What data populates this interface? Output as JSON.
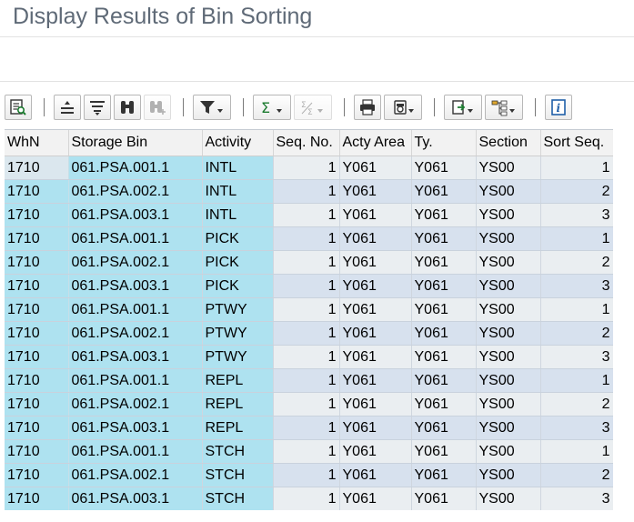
{
  "window": {
    "title": "Display Results of Bin Sorting"
  },
  "toolbar": {
    "buttons": [
      {
        "name": "details-icon",
        "disabled": false
      },
      {
        "name": "sort-ascending-icon",
        "disabled": false
      },
      {
        "name": "sort-descending-icon",
        "disabled": false
      },
      {
        "name": "find-icon",
        "disabled": false
      },
      {
        "name": "find-next-icon",
        "disabled": true
      },
      {
        "name": "filter-icon",
        "disabled": false
      },
      {
        "name": "total-icon",
        "disabled": false
      },
      {
        "name": "subtotal-icon",
        "disabled": true
      },
      {
        "name": "print-icon",
        "disabled": false
      },
      {
        "name": "views-icon",
        "disabled": false
      },
      {
        "name": "export-icon",
        "disabled": false
      },
      {
        "name": "layout-icon",
        "disabled": false
      },
      {
        "name": "info-icon",
        "disabled": false
      }
    ]
  },
  "table": {
    "columns": [
      "WhN",
      "Storage Bin",
      "Activity",
      "Seq. No.",
      "Acty Area",
      "Ty.",
      "Section",
      "Sort Seq."
    ],
    "rows": [
      [
        "1710",
        "061.PSA.001.1",
        "INTL",
        "1",
        "Y061",
        "Y061",
        "YS00",
        "1"
      ],
      [
        "1710",
        "061.PSA.002.1",
        "INTL",
        "1",
        "Y061",
        "Y061",
        "YS00",
        "2"
      ],
      [
        "1710",
        "061.PSA.003.1",
        "INTL",
        "1",
        "Y061",
        "Y061",
        "YS00",
        "3"
      ],
      [
        "1710",
        "061.PSA.001.1",
        "PICK",
        "1",
        "Y061",
        "Y061",
        "YS00",
        "1"
      ],
      [
        "1710",
        "061.PSA.002.1",
        "PICK",
        "1",
        "Y061",
        "Y061",
        "YS00",
        "2"
      ],
      [
        "1710",
        "061.PSA.003.1",
        "PICK",
        "1",
        "Y061",
        "Y061",
        "YS00",
        "3"
      ],
      [
        "1710",
        "061.PSA.001.1",
        "PTWY",
        "1",
        "Y061",
        "Y061",
        "YS00",
        "1"
      ],
      [
        "1710",
        "061.PSA.002.1",
        "PTWY",
        "1",
        "Y061",
        "Y061",
        "YS00",
        "2"
      ],
      [
        "1710",
        "061.PSA.003.1",
        "PTWY",
        "1",
        "Y061",
        "Y061",
        "YS00",
        "3"
      ],
      [
        "1710",
        "061.PSA.001.1",
        "REPL",
        "1",
        "Y061",
        "Y061",
        "YS00",
        "1"
      ],
      [
        "1710",
        "061.PSA.002.1",
        "REPL",
        "1",
        "Y061",
        "Y061",
        "YS00",
        "2"
      ],
      [
        "1710",
        "061.PSA.003.1",
        "REPL",
        "1",
        "Y061",
        "Y061",
        "YS00",
        "3"
      ],
      [
        "1710",
        "061.PSA.001.1",
        "STCH",
        "1",
        "Y061",
        "Y061",
        "YS00",
        "1"
      ],
      [
        "1710",
        "061.PSA.002.1",
        "STCH",
        "1",
        "Y061",
        "Y061",
        "YS00",
        "2"
      ],
      [
        "1710",
        "061.PSA.003.1",
        "STCH",
        "1",
        "Y061",
        "Y061",
        "YS00",
        "3"
      ]
    ]
  },
  "colors": {
    "title_text": "#5f6a77",
    "key_column": "#aee2f0",
    "row_odd": "#eaeef1",
    "row_even": "#d7e1ee",
    "header_bg": "#f2f2f2"
  }
}
